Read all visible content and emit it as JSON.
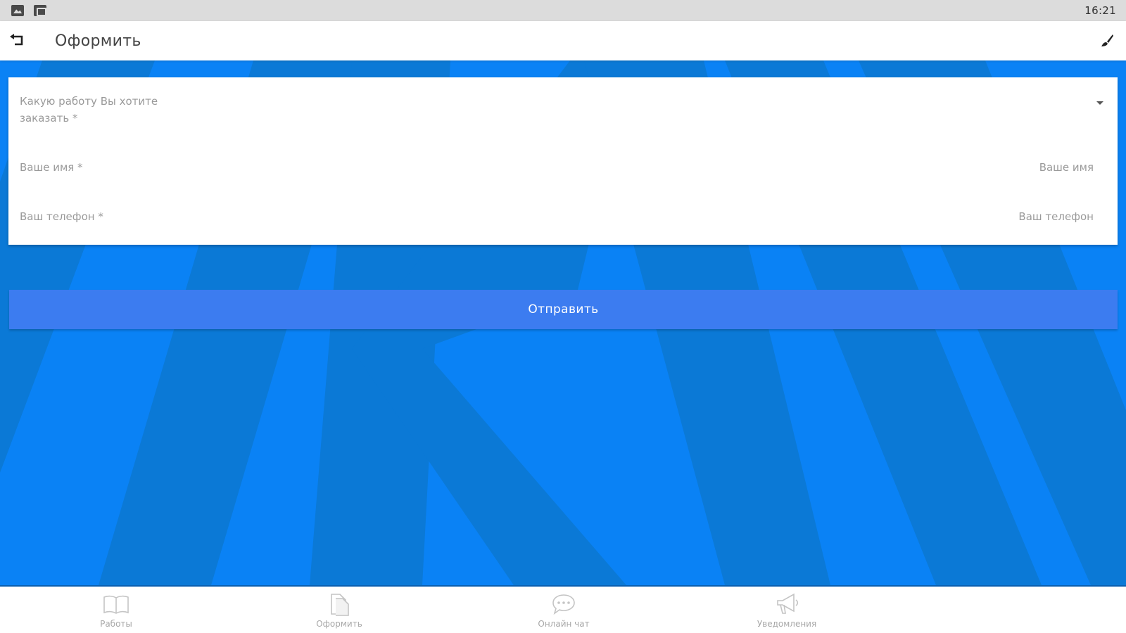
{
  "status_bar": {
    "time": "16:21",
    "icons": [
      "gallery-icon",
      "box-icon"
    ]
  },
  "app_bar": {
    "title": "Оформить",
    "back_icon": "back-arrow-icon",
    "action_icon": "brush-icon"
  },
  "form": {
    "work_select": {
      "label": "Какую работу Вы хотите заказать *",
      "value": ""
    },
    "name_field": {
      "label": "Ваше имя *",
      "placeholder": "Ваше имя",
      "value": ""
    },
    "phone_field": {
      "label": "Ваш телефон *",
      "placeholder": "Ваш телефон",
      "value": ""
    }
  },
  "submit": {
    "label": "Отправить"
  },
  "bottom_nav": {
    "items": [
      {
        "label": "Работы",
        "icon": "book-icon"
      },
      {
        "label": "Оформить",
        "icon": "document-icon"
      },
      {
        "label": "Онлайн чат",
        "icon": "chat-icon"
      },
      {
        "label": "Уведомления",
        "icon": "megaphone-icon"
      }
    ]
  },
  "colors": {
    "background": "#0a82f5",
    "stripes": "#0b79d6",
    "button": "#3c7cf0",
    "status_bar": "#dcdcdc"
  }
}
